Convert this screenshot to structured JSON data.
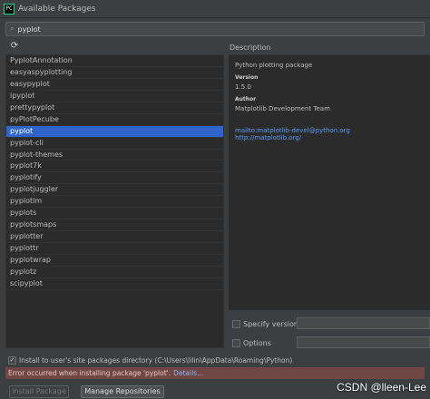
{
  "window": {
    "app_icon_text": "PC",
    "title": "Available Packages"
  },
  "search": {
    "icon": "search-icon",
    "value": "pyplot"
  },
  "toolbar": {
    "refresh_icon": "refresh-icon",
    "refresh_glyph": "⟳"
  },
  "packages": [
    "PyplotAnnotation",
    "easyaspyplotting",
    "easypyplot",
    "ipyplot",
    "prettypyplot",
    "pyPlotPecube",
    "pyplot",
    "pyplot-cli",
    "pyplot-themes",
    "pyplot7k",
    "pyplotify",
    "pyplotjuggler",
    "pyplotlm",
    "pyplots",
    "pyplotsmaps",
    "pyplotter",
    "pyplottr",
    "pyplotwrap",
    "pyplotz",
    "scipyplot"
  ],
  "selected_index": 6,
  "description": {
    "label": "Description",
    "summary": "Python plotting package",
    "version_heading": "Version",
    "version": "1.5.0",
    "author_heading": "Author",
    "author": "Matplotlib Development Team",
    "email": "mailto:matplotlib-devel@python.org",
    "url": "http://matplotlib.org/"
  },
  "options": {
    "specify_version_label": "Specify version",
    "options_label": "Options"
  },
  "install": {
    "checked": true,
    "check_glyph": "✓",
    "label": "Install to user's site packages directory (C:\\Users\\lilin\\AppData\\Roaming\\Python)"
  },
  "error": {
    "message": "Error occurred when installing package 'pyplot'.",
    "details_label": "Details..."
  },
  "buttons": {
    "install_label": "Install Package",
    "manage_label": "Manage Repositories"
  },
  "watermark": "CSDN @lleen-Lee"
}
